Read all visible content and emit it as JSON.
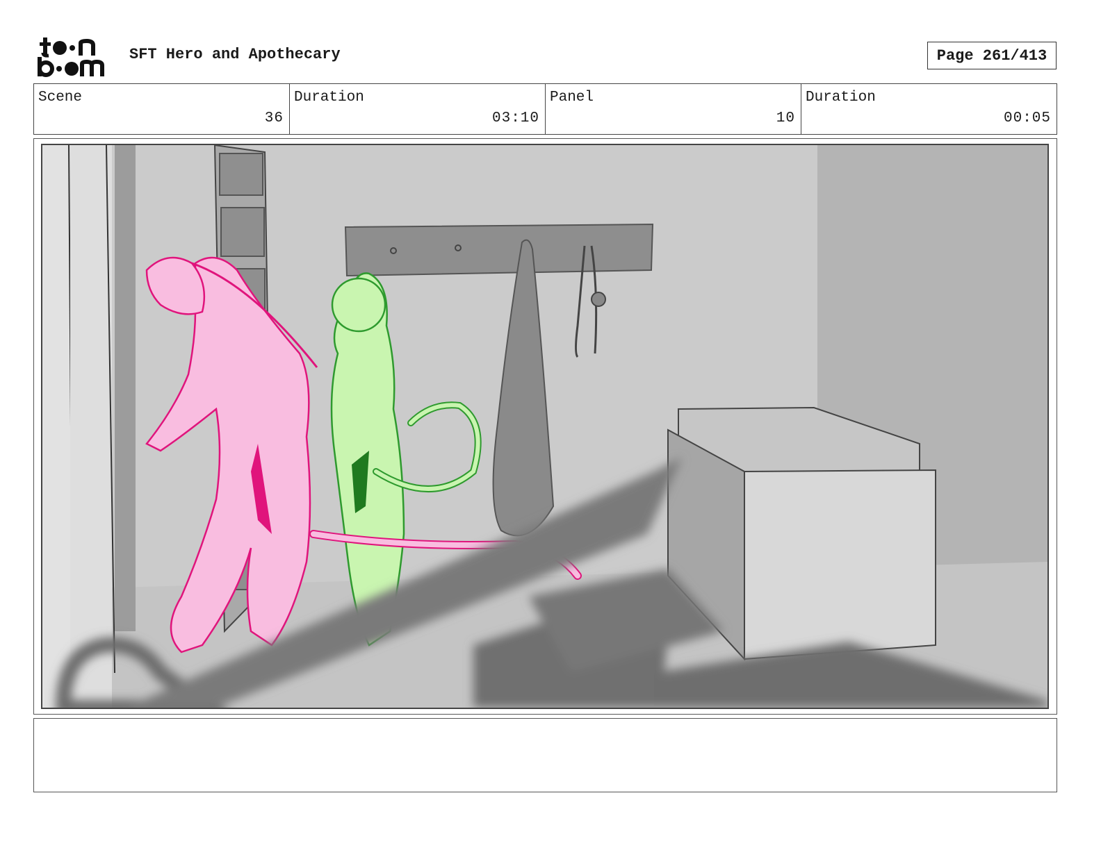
{
  "header": {
    "logo_text": "toonboom",
    "title": "SFT Hero and Apothecary",
    "page_label": "Page 261/413"
  },
  "info": [
    {
      "label": "Scene",
      "value": "36"
    },
    {
      "label": "Duration",
      "value": "03:10"
    },
    {
      "label": "Panel",
      "value": "10"
    },
    {
      "label": "Duration",
      "value": "00:05"
    }
  ],
  "panel": {
    "colors": {
      "pink_character": "#f9bde0",
      "pink_line": "#e0147c",
      "green_character": "#c9f5b0",
      "green_line": "#2e9a2e",
      "background": "#c9c9c9"
    }
  },
  "notes": {
    "text": ""
  }
}
